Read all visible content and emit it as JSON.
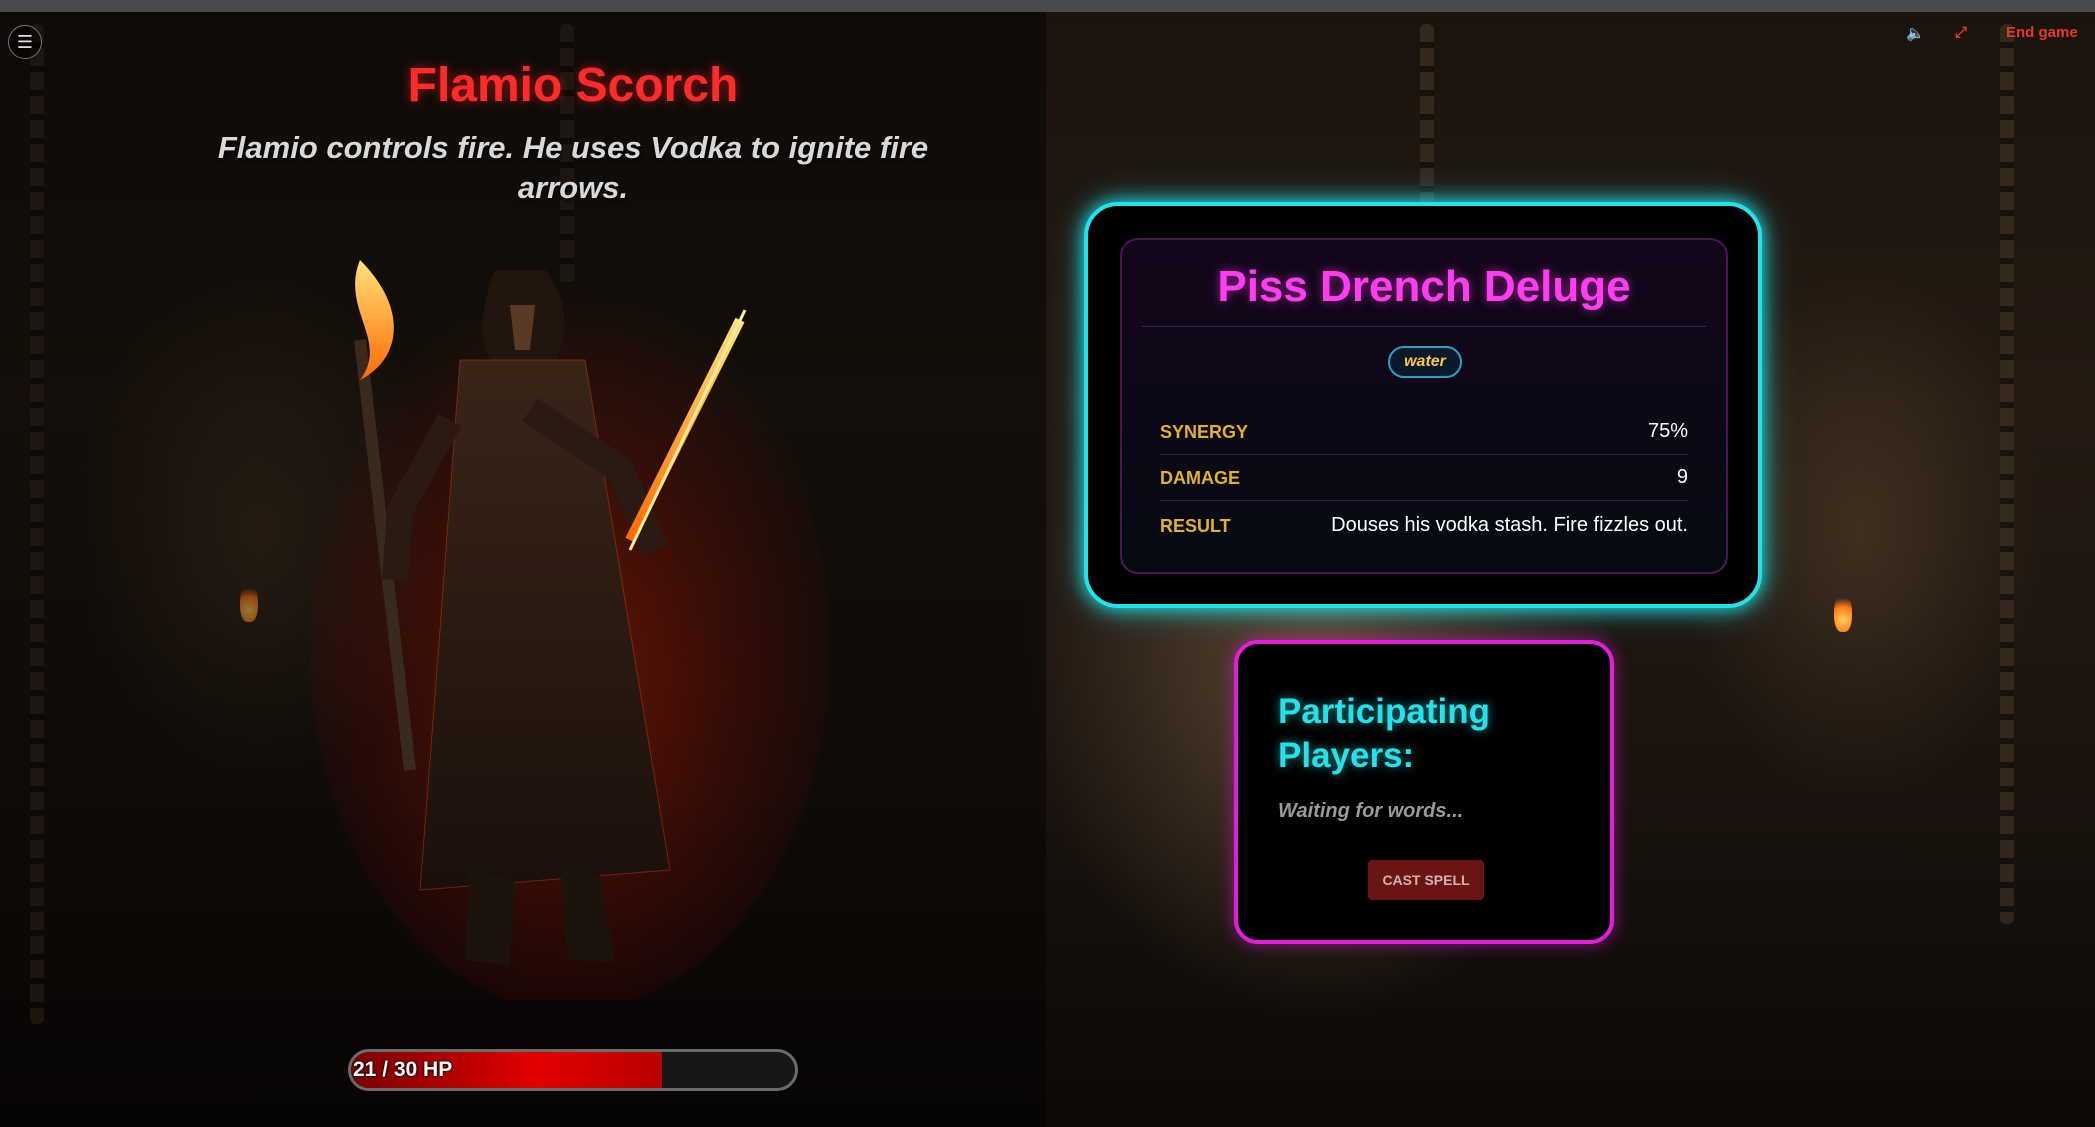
{
  "header": {
    "menu_icon": "hamburger-menu-icon",
    "sound_icon": "speaker-icon",
    "fullscreen_icon": "expand-icon",
    "end_game_label": "End game"
  },
  "boss": {
    "name": "Flamio Scorch",
    "description": "Flamio controls fire. He uses Vodka to ignite fire arrows.",
    "hp_current": 21,
    "hp_max": 30,
    "hp_text": "21 / 30 HP"
  },
  "spell": {
    "name": "Piss Drench Deluge",
    "element": "water",
    "stats": [
      {
        "label": "SYNERGY",
        "value": "75%"
      },
      {
        "label": "DAMAGE",
        "value": "9"
      },
      {
        "label": "RESULT",
        "value": "Douses his vodka stash. Fire fizzles out."
      }
    ]
  },
  "players": {
    "title": "Participating Players:",
    "status": "Waiting for words...",
    "cast_label": "CAST SPELL"
  },
  "colors": {
    "boss_name": "#ff2b2b",
    "spell_name": "#ff3df0",
    "cyan_accent": "#22e3ea",
    "magenta_accent": "#e21ed8",
    "stat_label": "#e3b12a",
    "hp_fill": "#e30000"
  }
}
